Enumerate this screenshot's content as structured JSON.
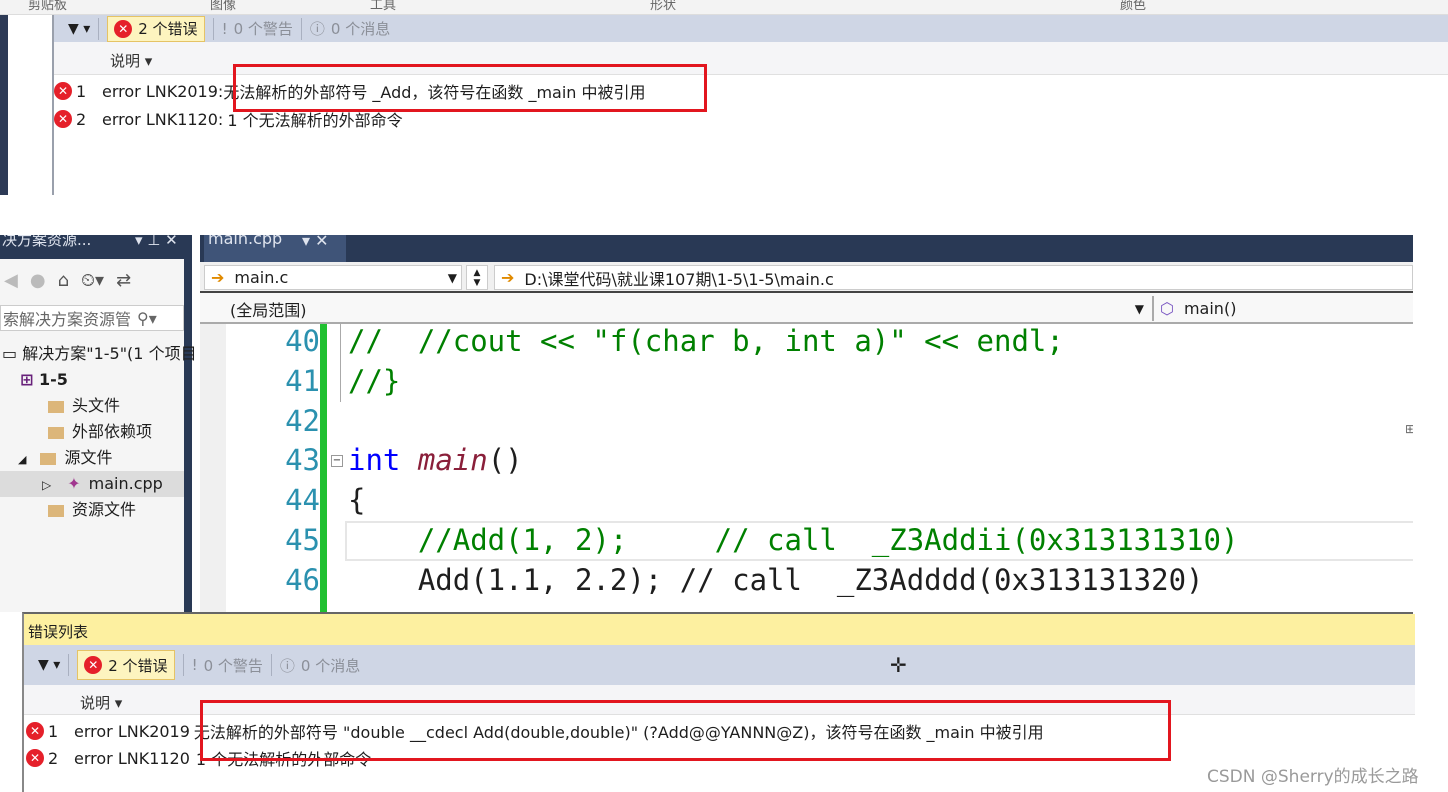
{
  "ribbon": {
    "groups": [
      "剪贴板",
      "图像",
      "工具",
      "形状",
      "颜色"
    ]
  },
  "top_error_list": {
    "filter_label": "▼",
    "errors_label": "2 个错误",
    "warnings_label": "0 个警告",
    "messages_label": "0 个消息",
    "column_header": "说明",
    "rows": [
      {
        "num": "1",
        "code": "error LNK2019:",
        "desc": "无法解析的外部符号 _Add，该符号在函数 _main 中被引用"
      },
      {
        "num": "2",
        "code": "error LNK1120:",
        "desc": "1 个无法解析的外部命令"
      }
    ]
  },
  "solution_explorer": {
    "title": "决方案资源...",
    "search_placeholder": "索解决方案资源管",
    "tree": [
      {
        "label": "解决方案\"1-5\"(1 个项目"
      },
      {
        "label": "1-5"
      },
      {
        "label": "头文件"
      },
      {
        "label": "外部依赖项"
      },
      {
        "label": "源文件"
      },
      {
        "label": "main.cpp",
        "selected": true
      },
      {
        "label": "资源文件"
      }
    ]
  },
  "editor": {
    "tab": "main.cpp",
    "file_dropdown": "main.c",
    "path": "D:\\课堂代码\\就业课107期\\1-5\\1-5\\main.c",
    "scope": "(全局范围)",
    "member": "main()",
    "lines": [
      {
        "n": "40",
        "text": "//  //cout << \"f(char b, int a)\" << endl;"
      },
      {
        "n": "41",
        "text": "//}"
      },
      {
        "n": "42",
        "text": ""
      },
      {
        "n": "43",
        "kw": "int",
        "fn": "main",
        "rest": "()"
      },
      {
        "n": "44",
        "text": "{"
      },
      {
        "n": "45",
        "text": "    //Add(1, 2);     // call  _Z3Addii(0x313131310)"
      },
      {
        "n": "46",
        "text": "    Add(1.1, 2.2); // call  _Z3Adddd(0x313131320)"
      }
    ]
  },
  "bottom_error_list": {
    "title": "错误列表",
    "errors_label": "2 个错误",
    "warnings_label": "0 个警告",
    "messages_label": "0 个消息",
    "column_header": "说明",
    "rows": [
      {
        "num": "1",
        "code": "error LNK2019",
        "desc": "无法解析的外部符号 \"double __cdecl Add(double,double)\" (?Add@@YANNN@Z)，该符号在函数 _main 中被引用"
      },
      {
        "num": "2",
        "code": "error LNK1120",
        "desc": "1 个无法解析的外部命令"
      }
    ]
  },
  "watermark": "CSDN @Sherry的成长之路",
  "colors": {
    "error": "#e5202a",
    "highlight_box": "#e2161f",
    "toolbar": "#cfd6e5",
    "title_yellow": "#fdf0a0",
    "dark_chrome": "#293955"
  }
}
